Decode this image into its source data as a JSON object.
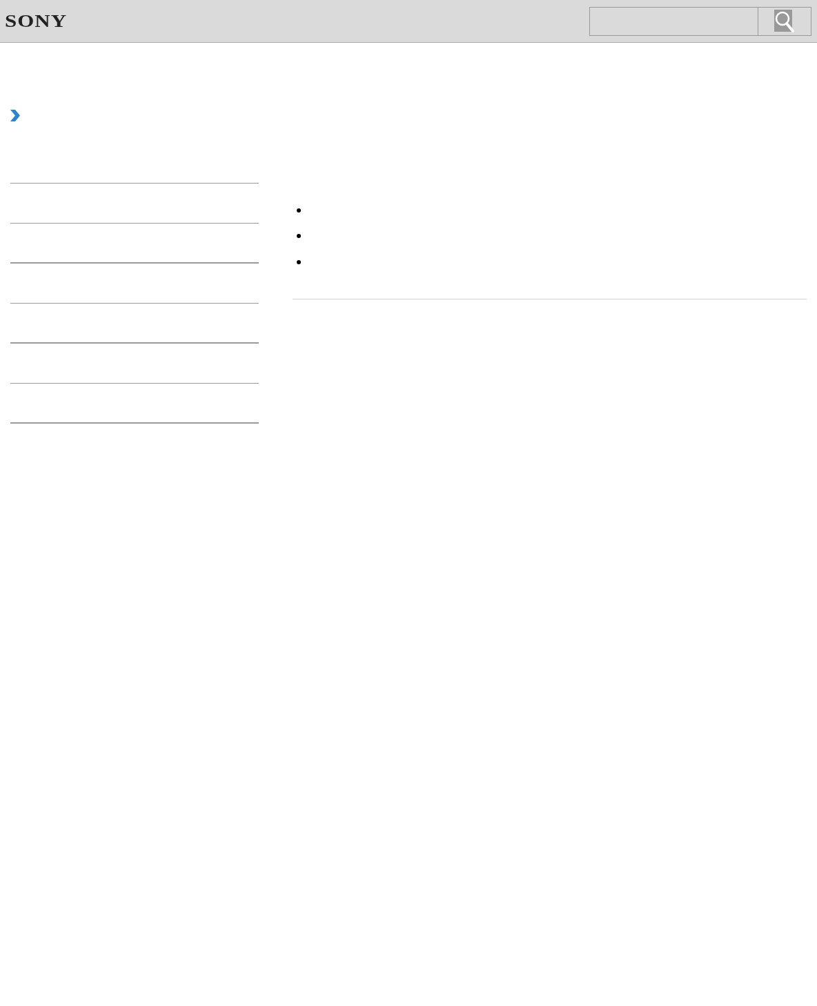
{
  "header": {
    "logo": "SONY"
  },
  "sidebar": {
    "dividers": [
      {
        "kind": "thin"
      },
      {
        "kind": "thin"
      },
      {
        "kind": "thick"
      },
      {
        "kind": "thin"
      },
      {
        "kind": "thick"
      },
      {
        "kind": "thin"
      },
      {
        "kind": "thick"
      }
    ]
  },
  "content": {
    "bullets": [
      {
        "kind": "bullet"
      },
      {
        "kind": "bullet"
      },
      {
        "kind": "bullet"
      }
    ]
  }
}
